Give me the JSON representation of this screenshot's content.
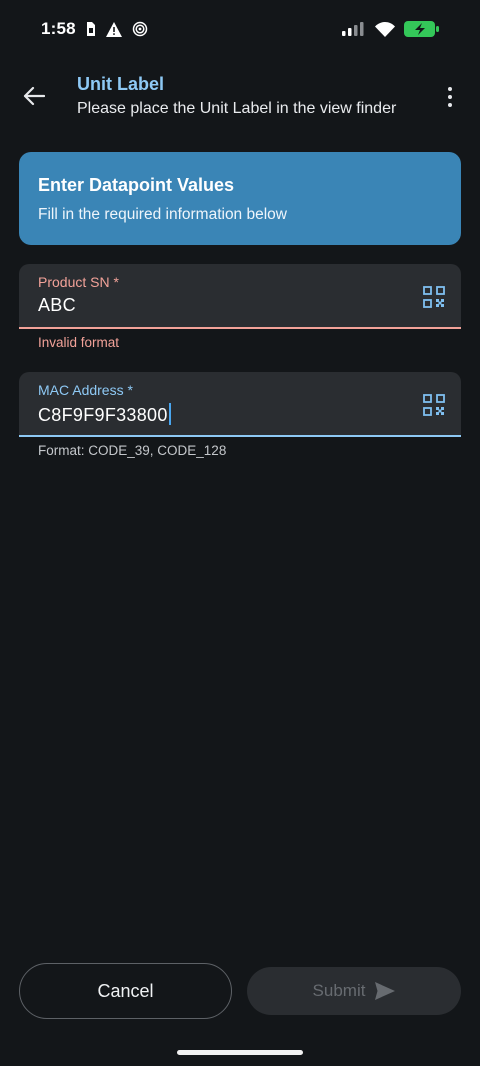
{
  "status_bar": {
    "time": "1:58",
    "left_icons": [
      "sim-card-icon",
      "warning-icon",
      "hotspot-icon"
    ],
    "right_icons": [
      "cellular-signal-icon",
      "wifi-icon",
      "battery-charging-icon"
    ]
  },
  "header": {
    "title": "Unit Label",
    "subtitle": "Please place the Unit Label in the view finder"
  },
  "info_card": {
    "title": "Enter Datapoint Values",
    "subtitle": "Fill in the required information below"
  },
  "fields": [
    {
      "label": "Product SN *",
      "value": "ABC",
      "helper": "Invalid format",
      "state": "error",
      "icon": "qr-scan-icon"
    },
    {
      "label": "MAC Address *",
      "value": "C8F9F9F33800",
      "helper": "Format: CODE_39, CODE_128",
      "state": "focused",
      "icon": "qr-scan-icon"
    }
  ],
  "actions": {
    "cancel_label": "Cancel",
    "submit_label": "Submit",
    "submit_enabled": false
  },
  "colors": {
    "background": "#131619",
    "title_accent": "#8ec9f5",
    "card": "#3a85b6",
    "error": "#f2a299",
    "focus": "#8ec9f5"
  }
}
